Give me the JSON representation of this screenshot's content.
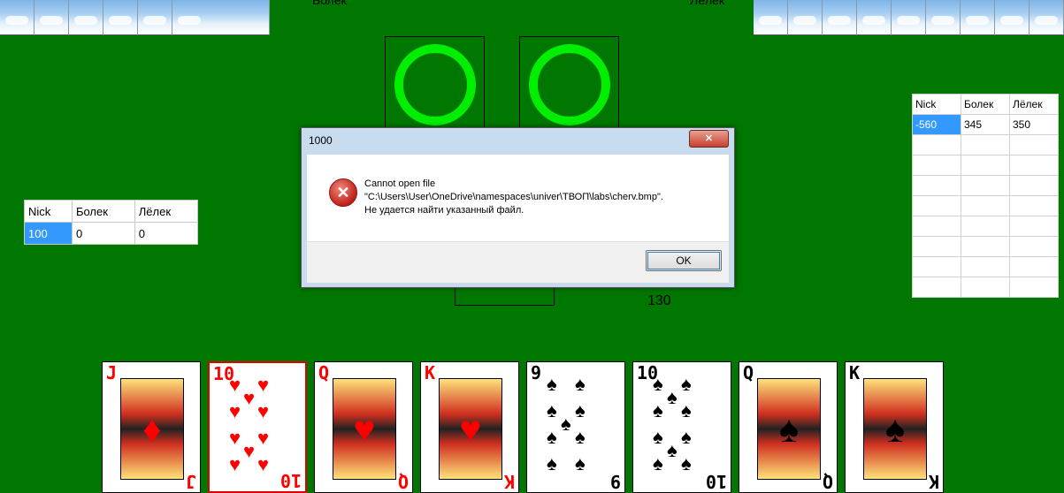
{
  "players": {
    "left_name": "Болек",
    "right_name": "Лёлек"
  },
  "left_table": {
    "headers": [
      "Nick",
      "Болек",
      "Лёлек"
    ],
    "row": [
      "100",
      "0",
      "0"
    ]
  },
  "right_table": {
    "headers": [
      "Nick",
      "Болек",
      "Лёлек"
    ],
    "row": [
      "-560",
      "345",
      "350"
    ]
  },
  "points": "130",
  "dialog": {
    "title": "1000",
    "close_label": "✕",
    "line1": "Cannot open file",
    "line2": "\"C:\\Users\\User\\OneDrive\\namespaces\\univer\\ТВОП\\labs\\cherv.bmp\".",
    "line3": "Не удается найти указанный файл.",
    "ok_label": "OK"
  },
  "hand": [
    {
      "rank": "J",
      "suit": "♦",
      "color": "red",
      "face": true
    },
    {
      "rank": "10",
      "suit": "♥",
      "color": "red",
      "face": false,
      "selected": true
    },
    {
      "rank": "Q",
      "suit": "♥",
      "color": "red",
      "face": true
    },
    {
      "rank": "K",
      "suit": "♥",
      "color": "red",
      "face": true
    },
    {
      "rank": "9",
      "suit": "♠",
      "color": "black",
      "face": false
    },
    {
      "rank": "10",
      "suit": "♠",
      "color": "black",
      "face": false
    },
    {
      "rank": "Q",
      "suit": "♠",
      "color": "black",
      "face": true
    },
    {
      "rank": "K",
      "suit": "♠",
      "color": "black",
      "face": true
    }
  ],
  "colors": {
    "table": "#007700",
    "ring": "#00ee00",
    "selection": "#3399ff"
  }
}
